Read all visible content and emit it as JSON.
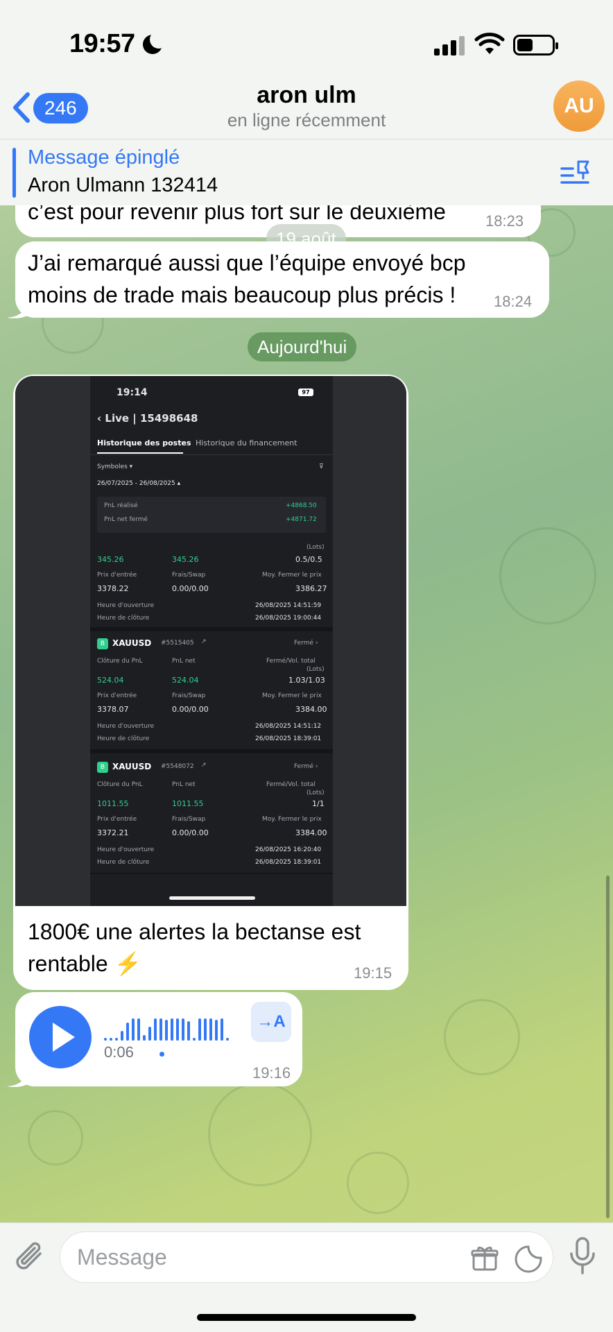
{
  "status_bar": {
    "time": "19:57"
  },
  "header": {
    "back_count": "246",
    "title": "aron ulm",
    "subtitle": "en ligne récemment",
    "avatar_initials": "AU"
  },
  "pinned": {
    "title": "Message épinglé",
    "text": "Aron Ulmann 132414"
  },
  "messages": {
    "partial": {
      "text": "c’est pour revenir plus fort sur le deuxième",
      "time": "18:23"
    },
    "date_pill_1": "19 août",
    "msg2": {
      "text": "J’ai remarqué aussi que l’équipe envoyé bcp moins de trade mais beaucoup plus précis !",
      "time": "18:24"
    },
    "date_pill_2": "Aujourd'hui",
    "photo_caption": {
      "text": "1800€ une alertes la bectanse est rentable ⚡",
      "time": "19:15"
    },
    "voice": {
      "duration": "0:06",
      "time": "19:16",
      "transcribe_label": "→A"
    }
  },
  "screenshot": {
    "time": "19:14",
    "battery": "97",
    "title": "Live | 15498648",
    "tab_active": "Historique des postes",
    "tab_other": "Historique du financement",
    "filter_label": "Symboles",
    "date_range": "26/07/2025 - 26/08/2025",
    "pnl_realise_label": "PnL réalisé",
    "pnl_realise_value": "+4868.50",
    "pnl_net_label": "PnL net fermé",
    "pnl_net_value": "+4871.72",
    "trade0": {
      "pnl": "345.26",
      "pnl_net": "345.26",
      "vol": "0.5/0.5",
      "lots": "(Lots)",
      "entry": "3378.22",
      "swap": "0.00/0.00",
      "close_price": "3386.27",
      "open_time": "26/08/2025 14:51:59",
      "close_time": "26/08/2025 19:00:44"
    },
    "labels": {
      "pnl_close": "Clôture du PnL",
      "pnl_net": "PnL net",
      "vol": "Fermé/Vol. total",
      "lots": "(Lots)",
      "entry": "Prix d'entrée",
      "swap": "Frais/Swap",
      "close_price": "Moy. Fermer le prix",
      "open_time": "Heure d'ouverture",
      "close_time": "Heure de clôture",
      "status": "Fermé",
      "tag": "B"
    },
    "trade1": {
      "symbol": "XAUUSD",
      "id": "#5515405",
      "pnl": "524.04",
      "pnl_net": "524.04",
      "vol": "1.03/1.03",
      "entry": "3378.07",
      "swap": "0.00/0.00",
      "close_price": "3384.00",
      "open_time": "26/08/2025 14:51:12",
      "close_time": "26/08/2025 18:39:01"
    },
    "trade2": {
      "symbol": "XAUUSD",
      "id": "#5548072",
      "pnl": "1011.55",
      "pnl_net": "1011.55",
      "vol": "1/1",
      "entry": "3372.21",
      "swap": "0.00/0.00",
      "close_price": "3384.00",
      "open_time": "26/08/2025 16:20:40",
      "close_time": "26/08/2025 18:39:01"
    }
  },
  "input": {
    "placeholder": "Message"
  },
  "colors": {
    "accent": "#3478f6",
    "profit_green": "#2fd08e",
    "avatar": "#f5a447"
  }
}
